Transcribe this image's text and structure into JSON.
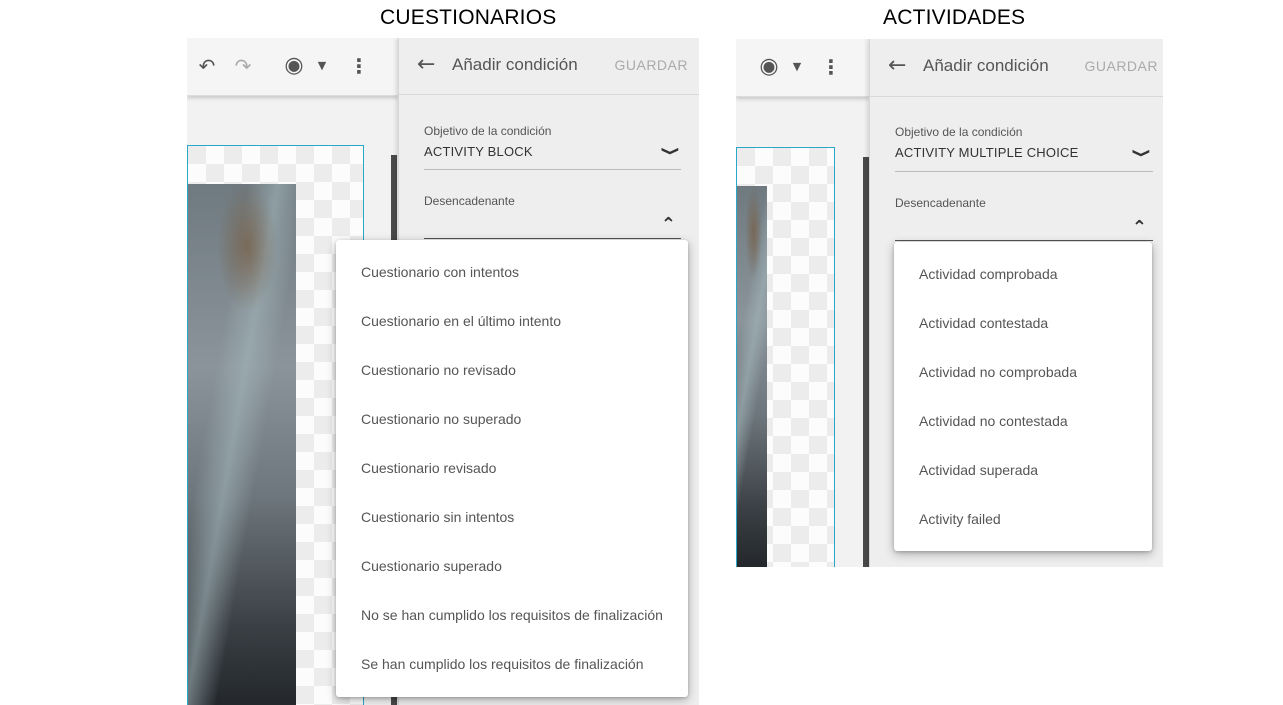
{
  "left": {
    "heading": "CUESTIONARIOS",
    "toolbar": {
      "undo_icon": "undo-icon",
      "redo_icon": "redo-icon",
      "preview_icon": "eye-icon",
      "more_icon": "more-vert-icon"
    },
    "panel": {
      "title": "Añadir condición",
      "save_label": "GUARDAR",
      "target_label": "Objetivo de la condición",
      "target_value": "ACTIVITY BLOCK",
      "trigger_label": "Desencadenante",
      "options": [
        "Cuestionario con intentos",
        "Cuestionario en el último intento",
        "Cuestionario no revisado",
        "Cuestionario no superado",
        "Cuestionario revisado",
        "Cuestionario sin intentos",
        "Cuestionario superado",
        "No se han cumplido los requisitos de finalización",
        "Se han cumplido los requisitos de finalización"
      ]
    }
  },
  "right": {
    "heading": "ACTIVIDADES",
    "panel": {
      "title": "Añadir condición",
      "save_label": "GUARDAR",
      "target_label": "Objetivo de la condición",
      "target_value": "ACTIVITY MULTIPLE CHOICE",
      "trigger_label": "Desencadenante",
      "options": [
        "Actividad comprobada",
        "Actividad contestada",
        "Actividad no comprobada",
        "Actividad no contestada",
        "Actividad superada",
        "Activity failed"
      ]
    }
  },
  "colors": {
    "accent_border": "#2aa7c9",
    "panel_bg": "#eeeeee",
    "disabled_text": "#aaaaaa"
  }
}
